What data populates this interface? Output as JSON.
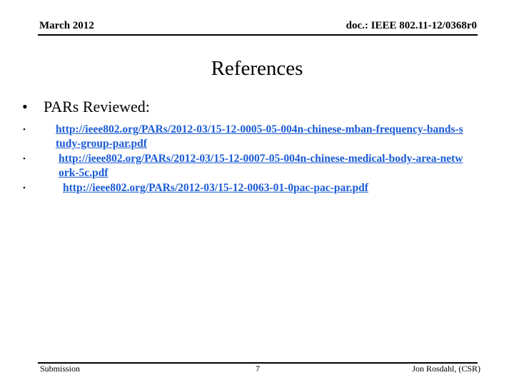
{
  "header": {
    "date": "March 2012",
    "doc_id": "doc.: IEEE 802.11-12/0368r0"
  },
  "slide": {
    "title": "References",
    "main_bullet": "PARs Reviewed:",
    "links": [
      {
        "text": "http://ieee802.org/PARs/2012-03/15-12-0005-05-004n-chinese-mban-frequency-bands-study-group-par.pdf"
      },
      {
        "text": "http://ieee802.org/PARs/2012-03/15-12-0007-05-004n-chinese-medical-body-area-network-5c.pdf"
      },
      {
        "text": "http://ieee802.org/PARs/2012-03/15-12-0063-01-0pac-pac-par.pdf"
      }
    ],
    "bullet_glyph": "•",
    "link_color": "#1a5bd6"
  },
  "footer": {
    "left": "Submission",
    "page_number": "7",
    "author": "Jon Rosdahl, (CSR)"
  }
}
